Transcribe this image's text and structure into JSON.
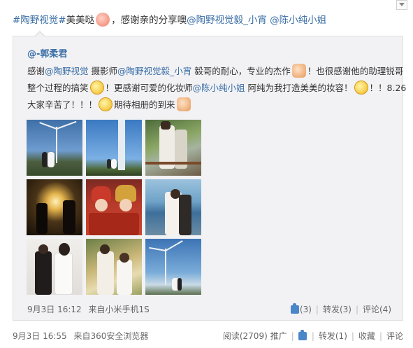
{
  "post": {
    "topic": "#陶野视觉#",
    "text_a": "美美哒",
    "text_b": "，感谢亲的分享噢",
    "mention_1": "@陶野视觉毅_小宵",
    "mention_2": "@陈小纯小姐"
  },
  "repost": {
    "author": "@-郭柔君",
    "line1_a": "感谢",
    "line1_m1": "@陶野视觉",
    "line1_b": " 摄影师",
    "line1_m2": "@陶野视觉毅_小宵",
    "line1_c": " 毅哥的耐心，专业的杰作",
    "line1_d": "！也很感谢他的助理锐哥",
    "line2_a": "整个过程的搞笑",
    "line2_b": "！更感谢可爱的化妆师",
    "line2_m": "@陈小纯小姐",
    "line2_c": " 阿纯为我打造美美的妆容！",
    "line2_d": "！！8.26",
    "line3_a": "大家辛苦了！！！",
    "line3_b": "期待相册的到来",
    "time": "9月3日 16:12",
    "source": "来自小米手机1S",
    "like_count": "(3)",
    "forward_label": "转发(3)",
    "comment_label": "评论(4)"
  },
  "footer": {
    "time": "9月3日 16:55",
    "source": "来自360安全浏览器",
    "read_label": "阅读(2709)",
    "promote_label": "推广",
    "forward_label": "转发(1)",
    "favorite_label": "收藏",
    "comment_label": "评论"
  },
  "icons": {
    "emoji_1": "gift-face-icon",
    "emoji_thumbs": "thumbs-up-icon",
    "emoji_laugh": "laugh-icon",
    "emoji_love": "love-eyes-icon",
    "emoji_shy": "shy-icon",
    "emoji_hand": "wave-hand-icon",
    "like": "like-icon",
    "menu": "chevron-down-icon"
  },
  "photos": [
    {
      "scene": "wind turbine couple blue sky"
    },
    {
      "scene": "wind turbine tower close"
    },
    {
      "scene": "couple bride groom terrace"
    },
    {
      "scene": "couple silhouette lamp night"
    },
    {
      "scene": "traditional chinese red costume couple"
    },
    {
      "scene": "couple sea veil kiss"
    },
    {
      "scene": "couple white wall studio"
    },
    {
      "scene": "bride groom sunlight"
    },
    {
      "scene": "wind turbine couple sky"
    }
  ]
}
